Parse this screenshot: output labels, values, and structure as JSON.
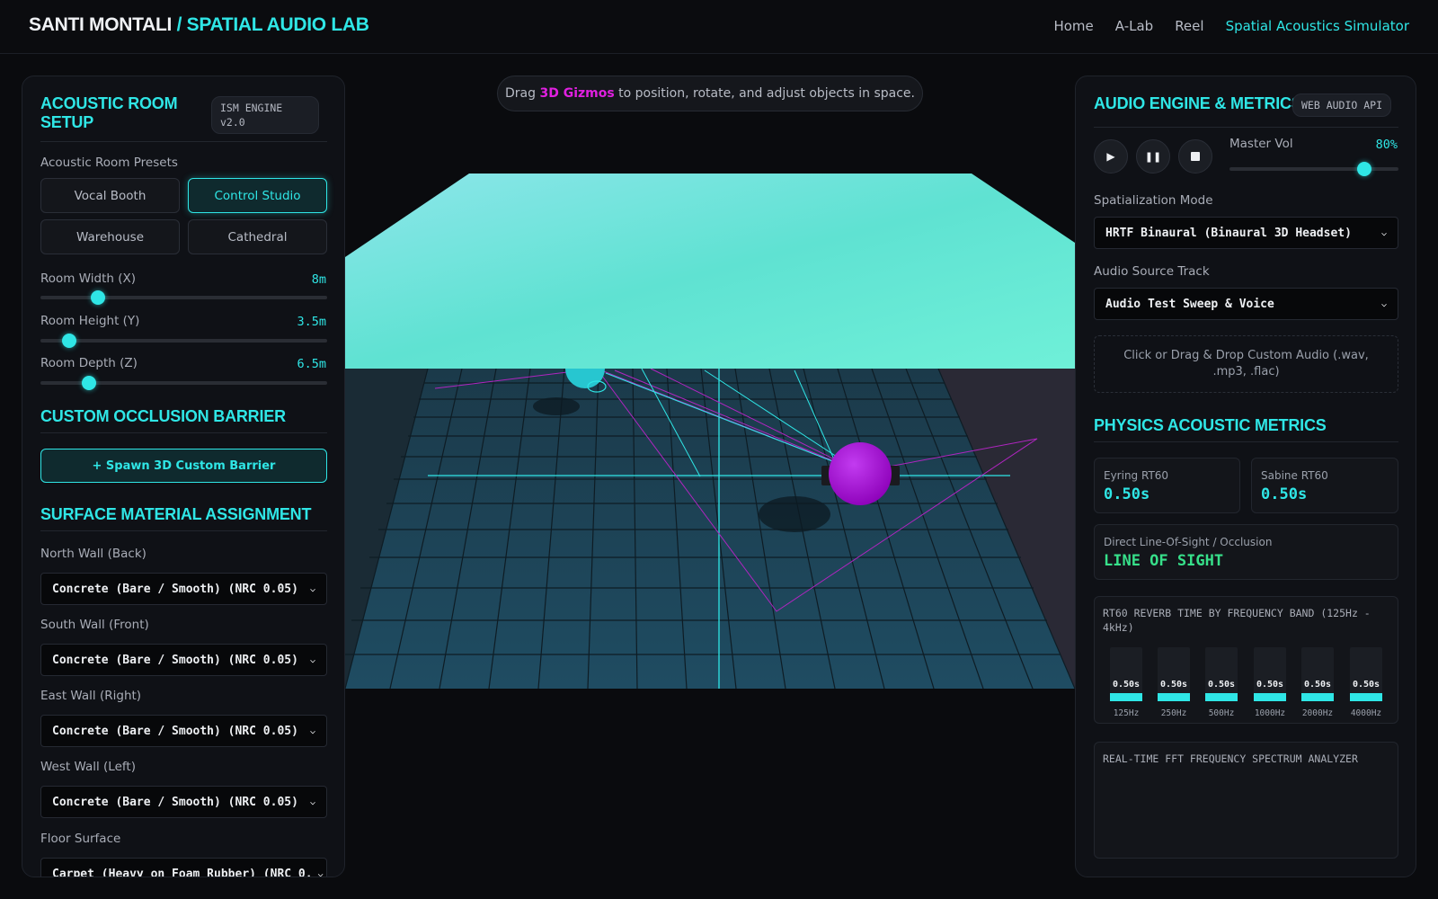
{
  "header": {
    "brand_name": "SANTI MONTALI",
    "brand_lab": " / SPATIAL AUDIO LAB",
    "nav": [
      "Home",
      "A-Lab",
      "Reel",
      "Spatial Acoustics Simulator"
    ],
    "active_nav": "Spatial Acoustics Simulator"
  },
  "left_panel": {
    "title": "ACOUSTIC ROOM SETUP",
    "engine_badge": "ISM ENGINE v2.0",
    "presets_label": "Acoustic Room Presets",
    "presets": [
      "Vocal Booth",
      "Control Studio",
      "Warehouse",
      "Cathedral"
    ],
    "active_preset": "Control Studio",
    "sliders": [
      {
        "label": "Room Width (X)",
        "value": "8m",
        "fraction": 0.2
      },
      {
        "label": "Room Height (Y)",
        "value": "3.5m",
        "fraction": 0.1
      },
      {
        "label": "Room Depth (Z)",
        "value": "6.5m",
        "fraction": 0.17
      }
    ],
    "occlusion_title": "CUSTOM OCCLUSION BARRIER",
    "spawn_button": "+ Spawn 3D Custom Barrier",
    "materials_title": "SURFACE MATERIAL ASSIGNMENT",
    "materials": [
      {
        "label": "North Wall (Back)",
        "value": "Concrete (Bare / Smooth) (NRC 0.05)"
      },
      {
        "label": "South Wall (Front)",
        "value": "Concrete (Bare / Smooth) (NRC 0.05)"
      },
      {
        "label": "East Wall (Right)",
        "value": "Concrete (Bare / Smooth) (NRC 0.05)"
      },
      {
        "label": "West Wall (Left)",
        "value": "Concrete (Bare / Smooth) (NRC 0.05)"
      },
      {
        "label": "Floor Surface",
        "value": "Carpet (Heavy on Foam Rubber) (NRC 0."
      }
    ]
  },
  "viewport": {
    "hint_pre": "Drag ",
    "hint_highlight": "3D Gizmos",
    "hint_post": " to position, rotate, and adjust objects in space."
  },
  "right_panel": {
    "title": "AUDIO ENGINE & METRICS",
    "api_badge": "WEB AUDIO API",
    "master_vol_label": "Master Vol",
    "master_vol_value": "80%",
    "master_vol_fraction": 0.8,
    "spatial_label": "Spatialization Mode",
    "spatial_value": "HRTF Binaural (Binaural 3D Headset)",
    "track_label": "Audio Source Track",
    "track_value": "Audio Test Sweep & Voice",
    "drop_text": "Click or Drag & Drop Custom Audio (.wav, .mp3, .flac)",
    "metrics_title": "PHYSICS ACOUSTIC METRICS",
    "eyring_label": "Eyring RT60",
    "eyring_value": "0.50s",
    "sabine_label": "Sabine RT60",
    "sabine_value": "0.50s",
    "los_label": "Direct Line-Of-Sight / Occlusion",
    "los_value": "LINE OF SIGHT",
    "bands_title": "RT60 REVERB TIME BY FREQUENCY BAND (125Hz - 4kHz)",
    "bands": [
      {
        "freq": "125Hz",
        "value": "0.50s"
      },
      {
        "freq": "250Hz",
        "value": "0.50s"
      },
      {
        "freq": "500Hz",
        "value": "0.50s"
      },
      {
        "freq": "1000Hz",
        "value": "0.50s"
      },
      {
        "freq": "2000Hz",
        "value": "0.50s"
      },
      {
        "freq": "4000Hz",
        "value": "0.50s"
      }
    ],
    "fft_title": "REAL-TIME FFT FREQUENCY SPECTRUM ANALYZER"
  },
  "colors": {
    "accent": "#2fe6e6",
    "gizmo": "#e020e0",
    "ok": "#37e08a"
  },
  "icons": [
    "play-icon",
    "pause-icon",
    "stop-icon",
    "chevron-down-icon"
  ]
}
